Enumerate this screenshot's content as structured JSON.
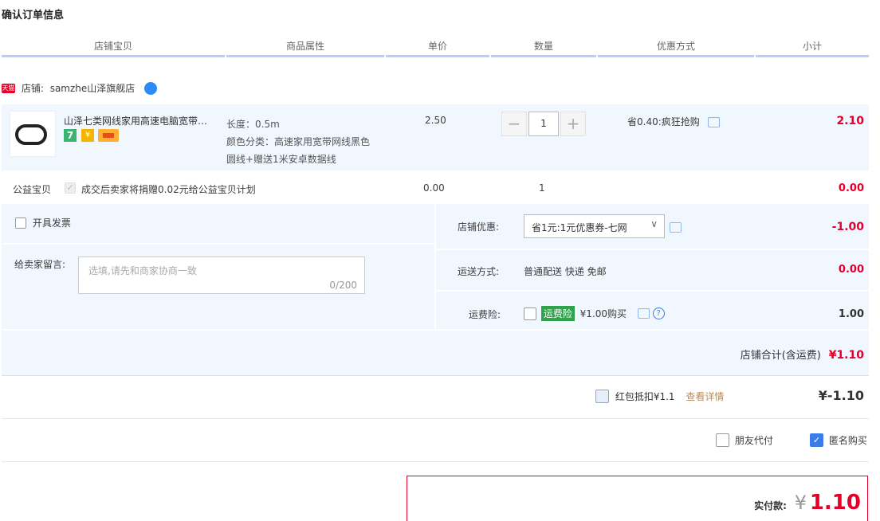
{
  "page": {
    "title": "确认订单信息"
  },
  "columns": [
    "店铺宝贝",
    "商品属性",
    "单价",
    "数量",
    "优惠方式",
    "小计"
  ],
  "shop": {
    "tmall_badge": "天猫",
    "label": "店铺:",
    "name": "samzhe山泽旗舰店"
  },
  "item": {
    "title": "山泽七类网线家用高速电脑宽带…",
    "badge_seven": "7",
    "attr_length": "长度：0.5m",
    "attr_color_line1": "颜色分类：高速家用宽带网线黑色",
    "attr_color_line2": "圆线+赠送1米安卓数据线",
    "price": "2.50",
    "qty": "1",
    "qty_minus": "−",
    "qty_plus": "+",
    "promo": "省0.40:疯狂抢购",
    "subtotal": "2.10"
  },
  "charity": {
    "label": "公益宝贝",
    "text": "成交后卖家将捐赠0.02元给公益宝贝计划",
    "price": "0.00",
    "qty": "1",
    "subtotal": "0.00"
  },
  "invoice": {
    "label": "开具发票"
  },
  "message": {
    "label": "给卖家留言:",
    "placeholder": "选填,请先和商家协商一致",
    "counter": "0/200"
  },
  "shop_discount": {
    "label": "店铺优惠:",
    "selected": "省1元:1元优惠券-七网",
    "amount": "-1.00"
  },
  "shipping": {
    "label": "运送方式:",
    "value": "普通配送 快递 免邮",
    "amount": "0.00"
  },
  "insurance": {
    "label": "运费险:",
    "tag": "运费险",
    "text": "¥1.00购买",
    "amount": "1.00"
  },
  "shop_total": {
    "label": "店铺合计(含运费)",
    "amount": "¥1.10"
  },
  "red_packet": {
    "label": "红包抵扣¥1.1",
    "link": "查看详情",
    "amount": "¥-1.10"
  },
  "options": {
    "friend_pay": "朋友代付",
    "anonymous": "匿名购买"
  },
  "final": {
    "label": "实付款:",
    "currency": "¥",
    "amount": "1.10"
  },
  "colors": {
    "accent_red": "#e4002b",
    "header_line": "#b2d1ff",
    "panel_bg": "#f1f7ff",
    "check_blue": "#3b7de8"
  }
}
